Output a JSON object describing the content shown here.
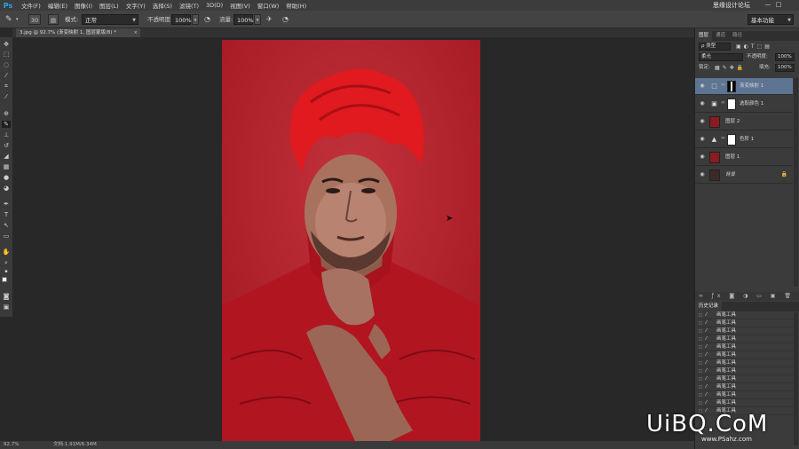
{
  "app": {
    "logo": "Ps"
  },
  "menu": [
    "文件(F)",
    "编辑(E)",
    "图像(I)",
    "图层(L)",
    "文字(Y)",
    "选择(S)",
    "滤镜(T)",
    "3D(D)",
    "视图(V)",
    "窗口(W)",
    "帮助(H)"
  ],
  "site_tag": "思缘设计论坛",
  "window_controls": {
    "minimize": "—",
    "maximize": "□"
  },
  "options": {
    "brush_size": "30",
    "mode_label": "模式:",
    "mode_value": "正常",
    "opacity_label": "不透明度:",
    "opacity_value": "100%",
    "flow_label": "流量:",
    "flow_value": "100%",
    "workspace": "基本功能"
  },
  "document_tab": {
    "title": "3.jpg @ 92.7% (渐变映射 1, 图层蒙版/8) *",
    "close": "×"
  },
  "status": {
    "zoom": "92.7%",
    "doc_size": "文档:1.91M/6.34M"
  },
  "layers_panel": {
    "tabs": [
      "图层",
      "通道",
      "路径"
    ],
    "filter_kind": "ρ 类型",
    "blend_mode": "柔光",
    "opacity_label": "不透明度:",
    "opacity_value": "100%",
    "lock_label": "锁定:",
    "fill_label": "填充:",
    "fill_value": "100%",
    "layers": [
      {
        "name": "渐变映射 1",
        "type": "adjustment",
        "icon": "□",
        "selected": true
      },
      {
        "name": "选取颜色 1",
        "type": "adjustment",
        "icon": "▣",
        "selected": false
      },
      {
        "name": "图层 2",
        "type": "pixel",
        "selected": false
      },
      {
        "name": "色阶 1",
        "type": "adjustment",
        "icon": "▲",
        "selected": false
      },
      {
        "name": "图层 1",
        "type": "pixel",
        "selected": false
      },
      {
        "name": "背景",
        "type": "background",
        "selected": false
      }
    ]
  },
  "history_panel": {
    "title": "历史记录",
    "items": [
      "画笔工具",
      "画笔工具",
      "画笔工具",
      "画笔工具",
      "画笔工具",
      "画笔工具",
      "画笔工具",
      "画笔工具",
      "画笔工具",
      "画笔工具",
      "画笔工具",
      "画笔工具",
      "画笔工具"
    ]
  },
  "watermark": {
    "text": "UiBQ.CoM",
    "url": "www.PSahz.com"
  },
  "colors": {
    "canvas_red": "#b51f2a",
    "selected_layer": "#5e7493",
    "panel_bg": "#3b3b3b"
  }
}
